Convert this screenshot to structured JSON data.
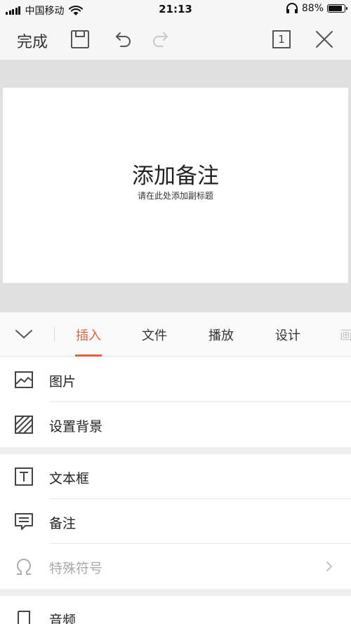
{
  "status_bar": {
    "carrier": "中国移动",
    "time": "21:13",
    "battery_percent_label": "88%",
    "battery_level": 0.88
  },
  "toolbar": {
    "done_label": "完成",
    "page_indicator": "1",
    "icons": [
      "save-icon",
      "undo-icon",
      "redo-icon",
      "page-count-icon",
      "close-icon"
    ]
  },
  "slide": {
    "title": "添加备注",
    "subtitle": "请在此处添加副标题"
  },
  "tabs": [
    {
      "label": "插入",
      "active": true
    },
    {
      "label": "文件",
      "active": false
    },
    {
      "label": "播放",
      "active": false
    },
    {
      "label": "设计",
      "active": false
    },
    {
      "label": "画",
      "active": false
    }
  ],
  "menu": {
    "group1": [
      {
        "label": "图片",
        "icon": "image-icon"
      },
      {
        "label": "设置背景",
        "icon": "background-icon"
      }
    ],
    "group2": [
      {
        "label": "文本框",
        "icon": "textbox-icon"
      },
      {
        "label": "备注",
        "icon": "note-icon"
      },
      {
        "label": "特殊符号",
        "icon": "omega-icon",
        "disabled": true
      }
    ],
    "group3": [
      {
        "label": "音频",
        "icon": "audio-icon"
      }
    ]
  },
  "colors": {
    "accent": "#e8603b",
    "toolbar_bg": "#f6f6f6",
    "preview_bg": "#e0e0e0"
  }
}
